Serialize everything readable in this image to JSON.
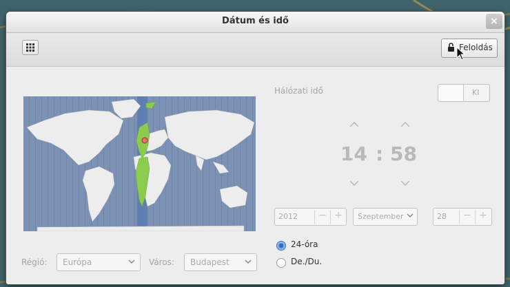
{
  "window": {
    "title": "Dátum és idő"
  },
  "toolbar": {
    "unlock_label": "Feloldás"
  },
  "network_time": {
    "label": "Hálózati idő",
    "switch_state": "KI"
  },
  "clock": {
    "hour": "14",
    "separator": ":",
    "minute": "58"
  },
  "date": {
    "year": "2012",
    "month": "Szeptember",
    "day": "28"
  },
  "time_format": {
    "option_24h": "24-óra",
    "option_ampm": "De./Du.",
    "selected": "24-óra"
  },
  "location": {
    "region_label": "Régió:",
    "region_value": "Európa",
    "city_label": "Város:",
    "city_value": "Budapest"
  },
  "spin_symbols": {
    "minus": "−",
    "plus": "+"
  },
  "colors": {
    "accent": "#3870c2",
    "timezone_highlight": "#8bcc4f",
    "map_ocean": "#7d93b5"
  }
}
